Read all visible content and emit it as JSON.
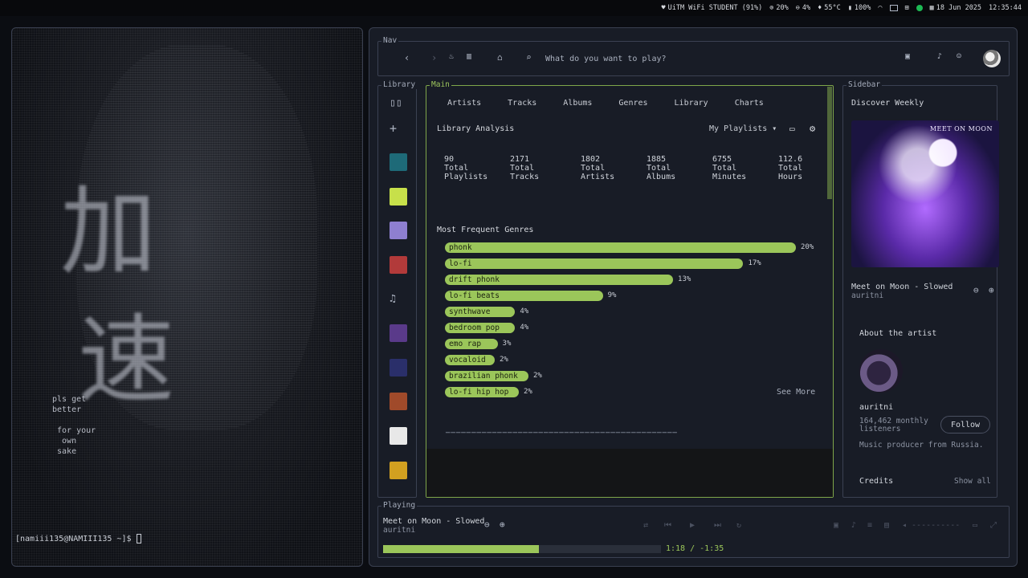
{
  "statusbar": {
    "wifi": "UiTM WiFi STUDENT (91%)",
    "cpu": "20%",
    "ram": "4%",
    "temp": "55°C",
    "battery": "100%",
    "date": "18 Jun 2025",
    "time": "12:35:44"
  },
  "terminal": {
    "kanji1": "加",
    "kanji2": "速",
    "note": "pls get\nbetter\n\n for your\n  own\n sake",
    "prompt": "[namiii135@NAMIII135 ~]$ "
  },
  "nav": {
    "title": "Nav",
    "search_placeholder": "What do you want to play?"
  },
  "library": {
    "title": "Library",
    "thumb_colors": [
      "#1e6a78",
      "#c7e04a",
      "#8e7fd0",
      "#b23a3a",
      "#5a3a8a",
      "#2a2f6a",
      "#a04a2a",
      "#e8e8e8",
      "#d2a020"
    ]
  },
  "main": {
    "title": "Main",
    "tabs": [
      "Artists",
      "Tracks",
      "Albums",
      "Genres",
      "Library",
      "Charts"
    ],
    "analysis_title": "Library Analysis",
    "dropdown": "My Playlists",
    "stats": [
      {
        "value": "90",
        "line1": "Total",
        "line2": "Playlists"
      },
      {
        "value": "2171",
        "line1": "Total",
        "line2": "Tracks"
      },
      {
        "value": "1802",
        "line1": "Total",
        "line2": "Artists"
      },
      {
        "value": "1885",
        "line1": "Total",
        "line2": "Albums"
      },
      {
        "value": "6755",
        "line1": "Total",
        "line2": "Minutes"
      },
      {
        "value": "112.6",
        "line1": "Total",
        "line2": "Hours"
      }
    ],
    "genres_title": "Most Frequent Genres",
    "genres": [
      {
        "name": "phonk",
        "pct": 20,
        "label": "20%"
      },
      {
        "name": "lo-fi",
        "pct": 17,
        "label": "17%"
      },
      {
        "name": "drift phonk",
        "pct": 13,
        "label": "13%"
      },
      {
        "name": "lo-fi beats",
        "pct": 9,
        "label": "9%"
      },
      {
        "name": "synthwave",
        "pct": 4,
        "label": "4%"
      },
      {
        "name": "bedroom pop",
        "pct": 4,
        "label": "4%"
      },
      {
        "name": "emo rap",
        "pct": 3,
        "label": "3%"
      },
      {
        "name": "vocaloid",
        "pct": 2,
        "label": "2%"
      },
      {
        "name": "brazilian phonk",
        "pct": 2,
        "label": "2%"
      },
      {
        "name": "lo-fi hip hop",
        "pct": 2,
        "label": "2%"
      }
    ],
    "see_more": "See More"
  },
  "sidebar": {
    "title": "Sidebar",
    "playlist": "Discover Weekly",
    "cover_text": "MEET ON MOON",
    "track": "Meet on Moon - Slowed",
    "artist": "auritni",
    "about_title": "About the artist",
    "artist_name": "auritni",
    "listeners": "164,462 monthly",
    "listeners2": "listeners",
    "follow": "Follow",
    "bio": "Music producer from Russia.",
    "credits": "Credits",
    "show_all": "Show all"
  },
  "playing": {
    "title": "Playing",
    "track": "Meet on Moon - Slowed",
    "artist": "auritni",
    "progress": 0.56,
    "time": "1:18 / -1:35"
  }
}
